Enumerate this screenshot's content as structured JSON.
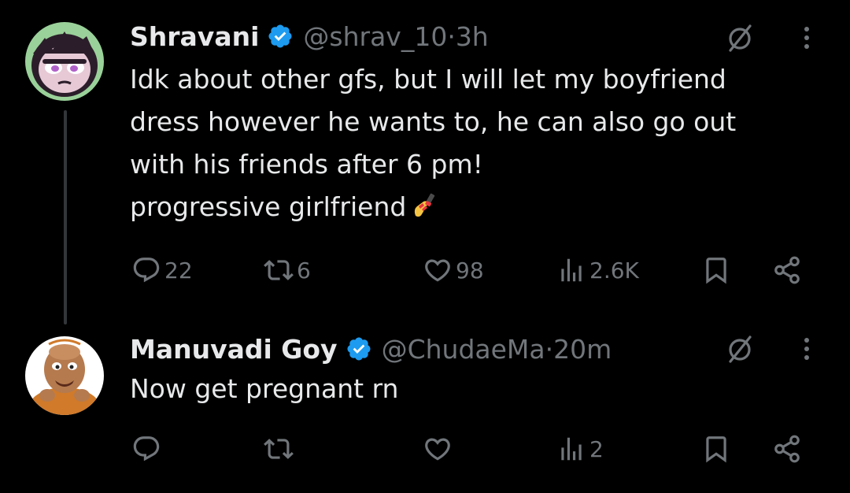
{
  "tweets": [
    {
      "author_name": "Shravani",
      "handle": "@shrav_10",
      "time": "3h",
      "text": "Idk about other gfs, but I will let my boyfriend\ndress however he wants to, he can also go out\nwith his friends after 6 pm!\nprogressive girlfriend",
      "emoji": "nail-polish-emoji",
      "reply_count": "22",
      "retweet_count": "6",
      "like_count": "98",
      "view_count": "2.6K"
    },
    {
      "author_name": "Manuvadi Goy",
      "handle": "@ChudaeMa",
      "time": "20m",
      "text": "Now get pregnant rn",
      "reply_count": "",
      "retweet_count": "",
      "like_count": "",
      "view_count": "2"
    }
  ],
  "separator": " · ",
  "colors": {
    "background": "#000000",
    "primary_text": "#e7e9ea",
    "secondary_text": "#71767b",
    "verified_badge": "#1d9bf0",
    "thread_line": "#333639"
  },
  "icons": {
    "verified": "verified-badge-icon",
    "grok": "grok-icon",
    "more": "more-options-icon",
    "reply": "reply-icon",
    "retweet": "retweet-icon",
    "like": "heart-icon",
    "views": "views-icon",
    "bookmark": "bookmark-icon",
    "share": "share-icon"
  }
}
